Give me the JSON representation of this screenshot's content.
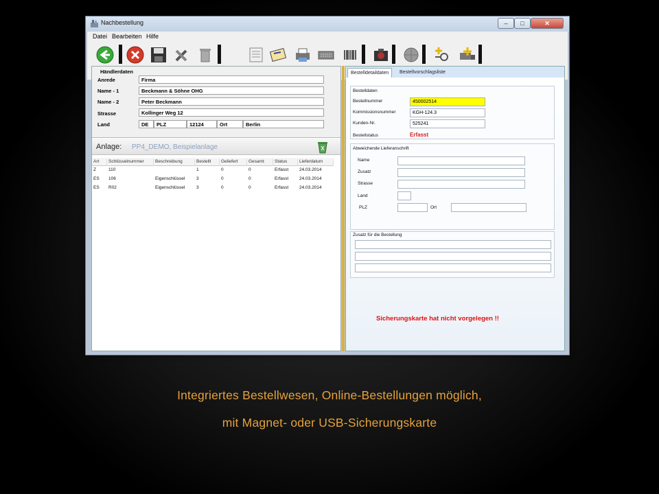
{
  "window": {
    "title": "Nachbestellung",
    "controls": [
      "–",
      "□",
      "✕"
    ]
  },
  "menu": [
    "Datei",
    "Bearbeiten",
    "Hilfe"
  ],
  "toolbar": {
    "icons": [
      "back-icon",
      "cancel-icon",
      "save-icon",
      "tools-icon",
      "delete-icon",
      "form-icon",
      "card-icon",
      "printer-icon",
      "keyboard-icon",
      "barcode-icon",
      "camera-icon",
      "globe-icon",
      "key-add-icon",
      "truck-add-icon"
    ]
  },
  "haendlerdaten": {
    "heading": "Händlerdaten",
    "anrede_label": "Anrede",
    "anrede": "Firma",
    "name1_label": "Name - 1",
    "name1": "Beckmann & Söhne OHG",
    "name2_label": "Name - 2",
    "name2": "Peter Beckmann",
    "strasse_label": "Strasse",
    "strasse": "Kollinger Weg 12",
    "land_label": "Land",
    "land": "DE",
    "plz_label": "PLZ",
    "plz": "12124",
    "ort_label": "Ort",
    "ort": "Berlin"
  },
  "anlage": {
    "label": "Anlage:",
    "value": "PP4_DEMO, Beispielanlage"
  },
  "table": {
    "headers": [
      "Art",
      "Schlüsselnummer",
      "Beschreibung",
      "Bestellt",
      "Geliefert",
      "Gesamt",
      "Status",
      "Lieferdatum"
    ],
    "rows": [
      [
        "Z",
        "110",
        "",
        "1",
        "0",
        "0",
        "Erfasst",
        "24.03.2014"
      ],
      [
        "ES",
        "106",
        "Eigenschlüssel",
        "3",
        "0",
        "0",
        "Erfasst",
        "24.03.2014"
      ],
      [
        "ES",
        "R02",
        "Eigenschlüssel",
        "3",
        "0",
        "0",
        "Erfasst",
        "24.03.2014"
      ]
    ]
  },
  "tabs": [
    "Bestelldetaildaten",
    "Bestellvorschlagsliste"
  ],
  "bestelldaten": {
    "title": "Bestelldaten",
    "bestellnummer_label": "Bestellnummer",
    "bestellnummer": "450002514",
    "kommissionsnummer_label": "Kommissionsnummer",
    "kommissionsnummer": "KGH-124.3",
    "kunden_label": "Kunden-Nr.",
    "kunden": "525241",
    "status_label": "Bestellstatus",
    "status": "Erfasst"
  },
  "lieferanschrift": {
    "title": "Abweichende Lieferanschrift",
    "name_label": "Name",
    "zusatz_label": "Zusatz",
    "strasse_label": "Strasse",
    "land_label": "Land",
    "plz_label": "PLZ",
    "ort_label": "Ort"
  },
  "zusatz": {
    "title": "Zusatz für die Bestellung"
  },
  "warning": "Sicherungskarte hat nicht vorgelegen !!",
  "caption": {
    "line1": "Integriertes Bestellwesen, Online-Bestellungen möglich,",
    "line2": "mit Magnet- oder USB-Sicherungskarte"
  },
  "colors": {
    "caption": "#e6a23c",
    "warning": "#e01010",
    "highlight_field": "#ffff00",
    "status": "#d42020"
  }
}
